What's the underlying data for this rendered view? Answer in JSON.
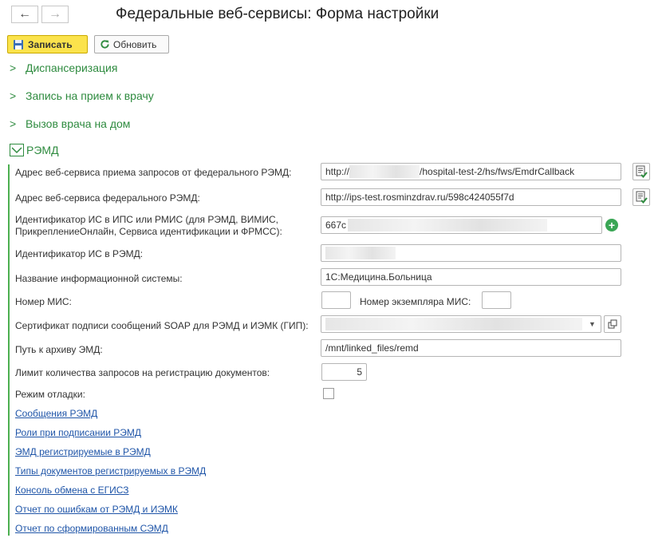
{
  "window": {
    "title": "Федеральные веб-сервисы: Форма настройки",
    "back_glyph": "←",
    "forward_glyph": "→"
  },
  "toolbar": {
    "save_label": "Записать",
    "refresh_label": "Обновить"
  },
  "sections": {
    "dispensary": "Диспансеризация",
    "appointment": "Запись на прием к врачу",
    "home_visit": "Вызов врача на дом",
    "remd": "РЭМД"
  },
  "form": {
    "callback_url_label": "Адрес веб-сервиса приема запросов от федерального РЭМД:",
    "callback_url_prefix": "http://",
    "callback_url_suffix": "/hospital-test-2/hs/fws/EmdrCallback",
    "federal_url_label": "Адрес веб-сервиса федерального РЭМД:",
    "federal_url_value": "http://ips-test.rosminzdrav.ru/598c424055f7d",
    "is_id_label_line1": "Идентификатор ИС в ИПС или РМИС (для РЭМД, ВИМИС,",
    "is_id_label_line2": "ПрикреплениеОнлайн, Сервиса идентификации и ФРМСС):",
    "is_id_value_prefix": "667c",
    "remd_id_label": "Идентификатор ИС в РЭМД:",
    "system_name_label": "Название информационной системы:",
    "system_name_value": "1С:Медицина.Больница",
    "mis_number_label": "Номер МИС:",
    "mis_instance_label": "Номер экземпляра МИС:",
    "certificate_label": "Сертификат подписи сообщений SOAP для РЭМД и ИЭМК (ГИП):",
    "archive_path_label": "Путь к архиву ЭМД:",
    "archive_path_value": "/mnt/linked_files/remd",
    "request_limit_label": "Лимит количества запросов на регистрацию документов:",
    "request_limit_value": "5",
    "debug_mode_label": "Режим отладки:",
    "debug_mode_checked": false
  },
  "links": [
    "Сообщения РЭМД",
    "Роли при подписании РЭМД",
    "ЭМД регистрируемые в РЭМД",
    "Типы документов регистрируемых в РЭМД",
    "Консоль обмена с ЕГИСЗ",
    "Отчет по ошибкам от РЭМД и ИЭМК",
    "Отчет по сформированным СЭМД"
  ],
  "colors": {
    "accent_green": "#2e8b3f",
    "save_yellow": "#fbe34c",
    "link_blue": "#1f55a8"
  }
}
